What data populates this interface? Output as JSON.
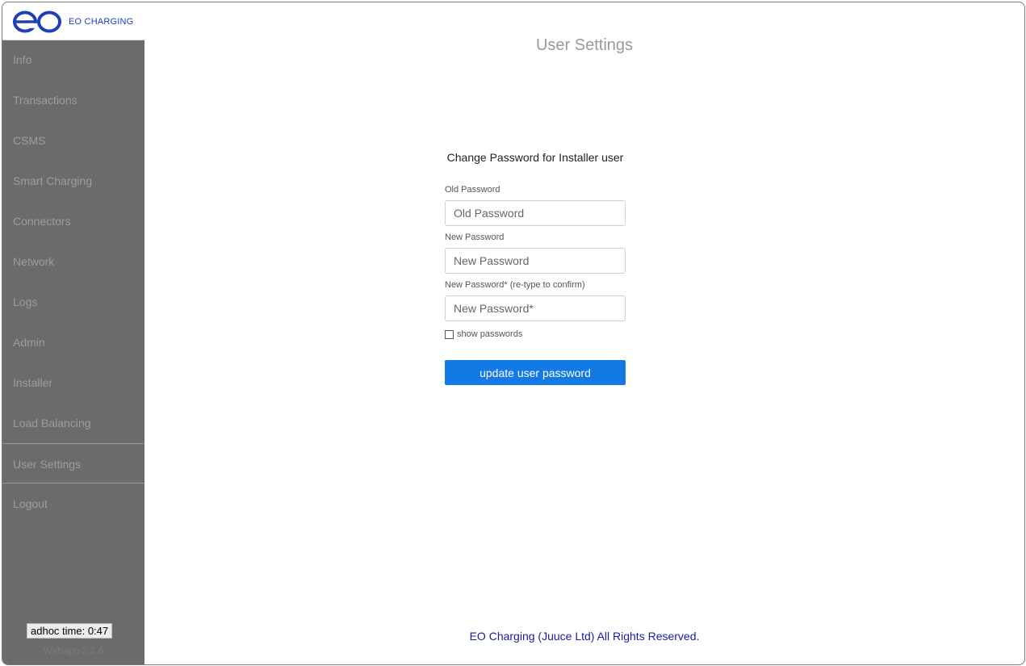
{
  "brand": {
    "logo_name": "eo-logo",
    "text": "EO CHARGING",
    "color": "#1e3fb5"
  },
  "sidebar": {
    "items": [
      {
        "label": "Info"
      },
      {
        "label": "Transactions"
      },
      {
        "label": "CSMS"
      },
      {
        "label": "Smart Charging"
      },
      {
        "label": "Connectors"
      },
      {
        "label": "Network"
      },
      {
        "label": "Logs"
      },
      {
        "label": "Admin"
      },
      {
        "label": "Installer"
      },
      {
        "label": "Load Balancing"
      },
      {
        "label": "User Settings",
        "active": true
      },
      {
        "label": "Logout"
      }
    ],
    "adhoc_time": "adhoc time: 0:47",
    "webapp_version": "Webapp 2.2.6",
    "background": "#6b6b6b"
  },
  "main": {
    "title": "User Settings",
    "form": {
      "heading": "Change Password for Installer user",
      "old_password": {
        "label": "Old Password",
        "placeholder": "Old Password"
      },
      "new_password": {
        "label": "New Password",
        "placeholder": "New Password"
      },
      "confirm_password": {
        "label": "New Password* (re-type to confirm)",
        "placeholder": "New Password*"
      },
      "show_passwords": "show passwords",
      "submit": "update user password",
      "accent": "#1279e5"
    },
    "footer": "EO Charging (Juuce Ltd) All Rights Reserved."
  }
}
